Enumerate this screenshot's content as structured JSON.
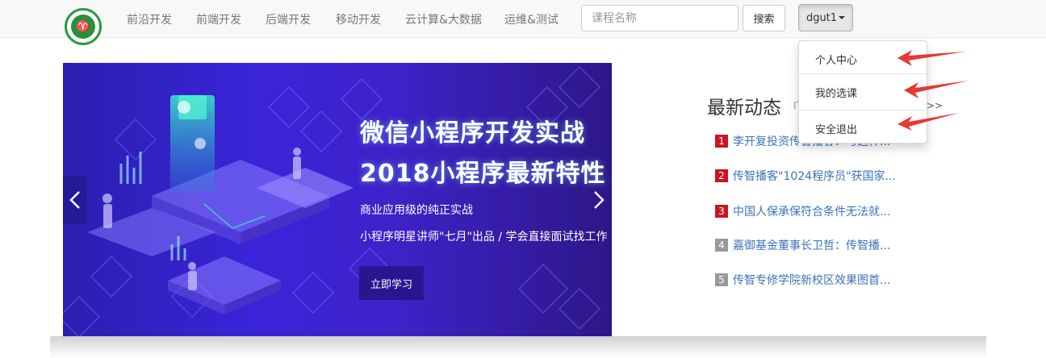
{
  "nav": {
    "items": [
      "前沿开发",
      "前端开发",
      "后端开发",
      "移动开发",
      "云计算&大数据",
      "运维&测试"
    ],
    "search_placeholder": "课程名称",
    "search_button": "搜索",
    "user_label": "dgut1"
  },
  "dropdown": {
    "items": [
      "个人中心",
      "我的选课",
      "安全退出"
    ]
  },
  "carousel": {
    "title_line1": "微信小程序开发实战",
    "title_line2": "2018小程序最新特性",
    "subtitle1": "商业应用级的纯正实战",
    "subtitle2": "小程序明星讲师\"七月\"出品 / 学会直接面试找工作",
    "button": "立即学习"
  },
  "news": {
    "title": "最新动态",
    "subtitle": "IT",
    "more": ">>",
    "items": [
      {
        "num": "1",
        "text": "李开复投资传智播客：与这样...",
        "color": "#c9151e"
      },
      {
        "num": "2",
        "text": "传智播客\"1024程序员\"获国家...",
        "color": "#c9151e"
      },
      {
        "num": "3",
        "text": "中国人保承保符合条件无法就...",
        "color": "#c9151e"
      },
      {
        "num": "4",
        "text": "嘉御基金董事长卫哲：传智播...",
        "color": "#999999"
      },
      {
        "num": "5",
        "text": "传智专修学院新校区效果图首...",
        "color": "#999999"
      }
    ]
  },
  "colors": {
    "accent_red": "#e53935",
    "link_blue": "#3b73b9"
  }
}
